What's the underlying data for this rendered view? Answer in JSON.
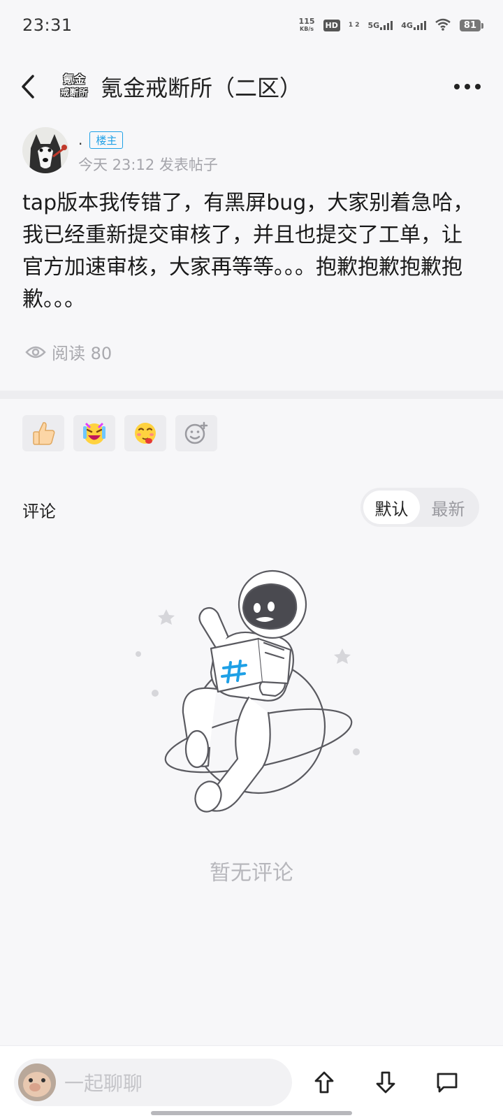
{
  "status_bar": {
    "time": "23:31",
    "speed_value": "115",
    "speed_unit": "KB/s",
    "hd_label": "HD",
    "hd_sub": "1 2",
    "net_5g": "5G",
    "net_4g": "4G",
    "battery": "81"
  },
  "navbar": {
    "logo_line1": "氪金",
    "logo_line2": "戒断所",
    "title": "氪金戒断所（二区）"
  },
  "post": {
    "author_name": ".",
    "author_badge": "楼主",
    "time": "今天 23:12 发表帖子",
    "body": "tap版本我传错了，有黑屏bug，大家别着急哈，我已经重新提交审核了，并且也提交了工单，让官方加速审核，大家再等等。。。抱歉抱歉抱歉抱歉。。。",
    "views_label": "阅读 80"
  },
  "reactions": [
    {
      "icon": "thumbs-up-icon"
    },
    {
      "icon": "laughing-emoji-icon"
    },
    {
      "icon": "drooling-emoji-icon"
    },
    {
      "icon": "add-emoji-icon"
    }
  ],
  "comments": {
    "label": "评论",
    "sort_default": "默认",
    "sort_latest": "最新",
    "active_sort": "默认",
    "empty_text": "暂无评论"
  },
  "bottom_bar": {
    "input_placeholder": "一起聊聊"
  },
  "colors": {
    "accent": "#1ea0e6",
    "background": "#f7f7f9",
    "muted_text": "#a5a5ab"
  }
}
